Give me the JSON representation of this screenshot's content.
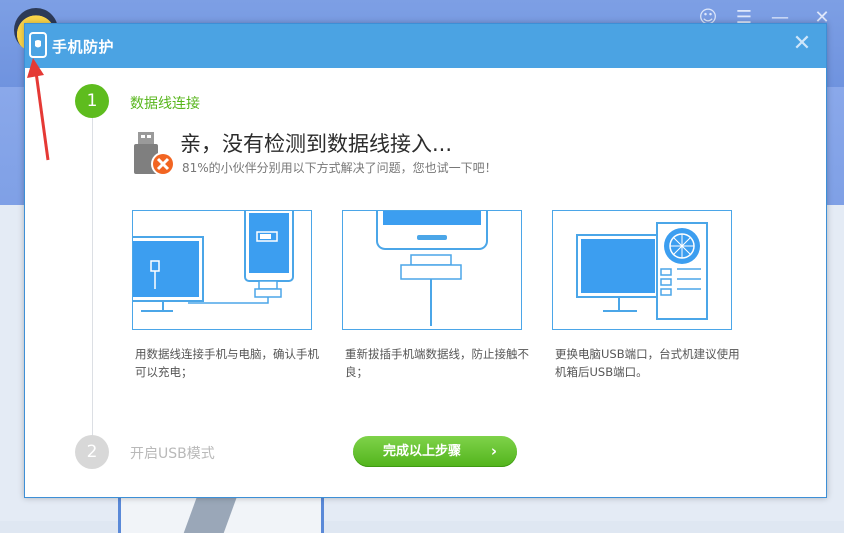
{
  "dialog": {
    "title": "手机防护",
    "close_glyph": "✕"
  },
  "background": {
    "controls": [
      "☺",
      "☰",
      "—",
      "✕"
    ]
  },
  "steps": [
    {
      "number": "1",
      "title": "数据线连接"
    },
    {
      "number": "2",
      "title": "开启USB模式"
    }
  ],
  "main": {
    "headline": "亲，没有检测到数据线接入...",
    "subline": "81%的小伙伴分别用以下方式解决了问题，您也试一下吧！"
  },
  "cards": [
    {
      "caption": "用数据线连接手机与电脑，确认手机可以充电；"
    },
    {
      "caption": "重新拔插手机端数据线，防止接触不良；"
    },
    {
      "caption": "更换电脑USB端口，台式机建议使用机箱后USB端口。"
    }
  ],
  "actions": {
    "next_label": "完成以上步骤",
    "next_chevron": "›"
  },
  "colors": {
    "accent_blue": "#4ba3e3",
    "accent_green": "#5ebc1e",
    "arrow_red": "#e53935"
  },
  "icons": [
    "shield-icon",
    "close-icon",
    "usb-disconnected-icon",
    "chevron-right-icon",
    "app-logo-icon"
  ]
}
